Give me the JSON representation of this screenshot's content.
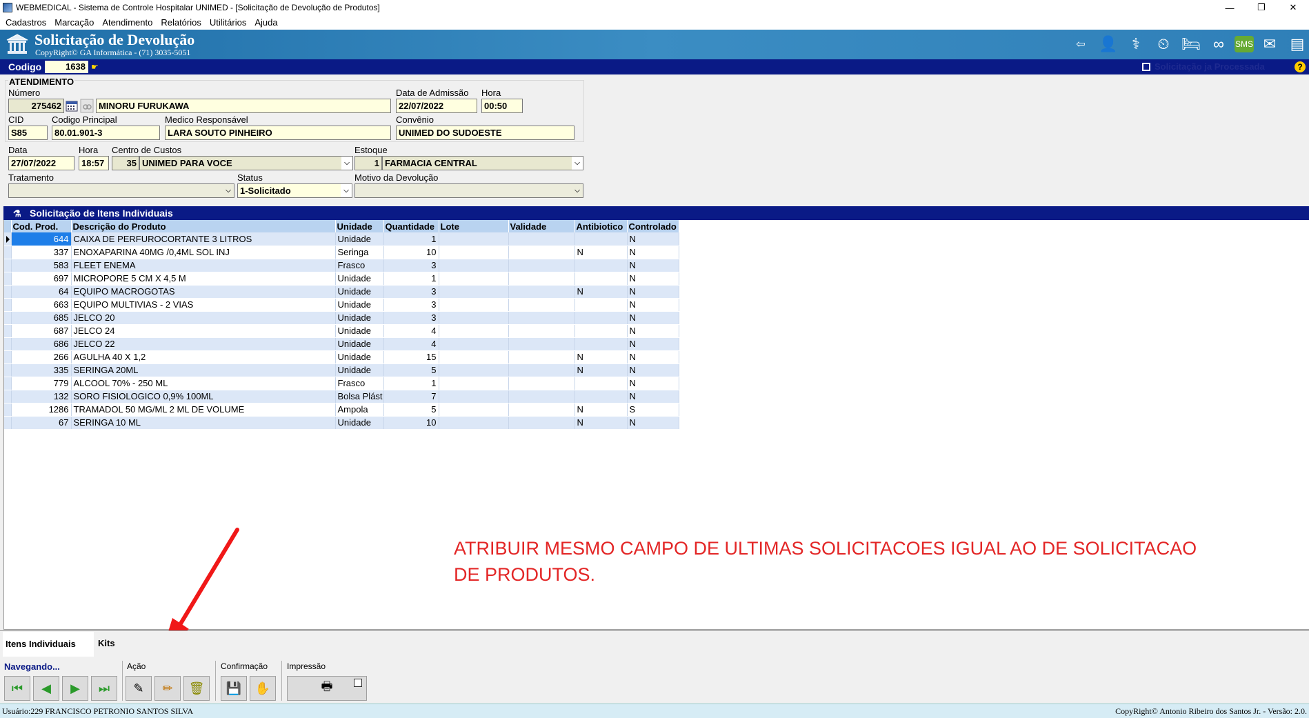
{
  "window": {
    "title": "WEBMEDICAL - Sistema de Controle Hospitalar UNIMED - [Solicitação de Devolução de Produtos]",
    "minimize": "—",
    "restore": "❐",
    "close": "✕"
  },
  "menu": [
    "Cadastros",
    "Marcação",
    "Atendimento",
    "Relatórios",
    "Utilitários",
    "Ajuda"
  ],
  "banner": {
    "title": "Solicitação de Devolução",
    "subtitle": "CopyRight© GA Informática - (71) 3035-5051"
  },
  "codebar": {
    "label": "Codigo",
    "value": "1638",
    "processed_label": "Solicitação ja Processada",
    "help": "?"
  },
  "atendimento": {
    "section_title": "ATENDIMENTO",
    "numero_label": "Número",
    "numero": "275462",
    "patient_name": "MINORU FURUKAWA",
    "admissao_label": "Data de Admissão",
    "admissao": "22/07/2022",
    "hora_label": "Hora",
    "hora": "00:50",
    "cid_label": "CID",
    "cid": "S85",
    "codigo_principal_label": "Codigo Principal",
    "codigo_principal": "80.01.901-3",
    "medico_label": "Medico Responsável",
    "medico": "LARA SOUTO PINHEIRO",
    "convenio_label": "Convênio",
    "convenio": "UNIMED DO SUDOESTE"
  },
  "solicitacao": {
    "data_label": "Data",
    "data": "27/07/2022",
    "hora_label": "Hora",
    "hora": "18:57",
    "centro_label": "Centro de Custos",
    "centro_code": "35",
    "centro_name": "UNIMED PARA VOCE",
    "estoque_label": "Estoque",
    "estoque_code": "1",
    "estoque_name": "FARMACIA CENTRAL",
    "tratamento_label": "Tratamento",
    "tratamento": "",
    "status_label": "Status",
    "status": "1-Solicitado",
    "motivo_label": "Motivo da Devolução",
    "motivo": ""
  },
  "grid": {
    "title": "Solicitação de Itens Individuais",
    "columns": [
      "Cod. Prod.",
      "Descrição do Produto",
      "Unidade",
      "Quantidade",
      "Lote",
      "Validade",
      "Antibiotico",
      "Controlado"
    ],
    "rows": [
      [
        "644",
        "CAIXA DE PERFUROCORTANTE 3 LITROS",
        "Unidade",
        "1",
        "",
        "",
        "",
        "N"
      ],
      [
        "337",
        "ENOXAPARINA 40MG /0,4ML SOL INJ",
        "Seringa",
        "10",
        "",
        "",
        "N",
        "N"
      ],
      [
        "583",
        "FLEET ENEMA",
        "Frasco",
        "3",
        "",
        "",
        "",
        "N"
      ],
      [
        "697",
        "MICROPORE  5 CM X 4,5 M",
        "Unidade",
        "1",
        "",
        "",
        "",
        "N"
      ],
      [
        "64",
        "EQUIPO MACROGOTAS",
        "Unidade",
        "3",
        "",
        "",
        "N",
        "N"
      ],
      [
        "663",
        "EQUIPO MULTIVIAS - 2 VIAS",
        "Unidade",
        "3",
        "",
        "",
        "",
        "N"
      ],
      [
        "685",
        "JELCO 20",
        "Unidade",
        "3",
        "",
        "",
        "",
        "N"
      ],
      [
        "687",
        "JELCO 24",
        "Unidade",
        "4",
        "",
        "",
        "",
        "N"
      ],
      [
        "686",
        "JELCO 22",
        "Unidade",
        "4",
        "",
        "",
        "",
        "N"
      ],
      [
        "266",
        "AGULHA 40 X 1,2",
        "Unidade",
        "15",
        "",
        "",
        "N",
        "N"
      ],
      [
        "335",
        "SERINGA 20ML",
        "Unidade",
        "5",
        "",
        "",
        "N",
        "N"
      ],
      [
        "779",
        "ALCOOL 70% - 250 ML",
        "Frasco",
        "1",
        "",
        "",
        "",
        "N"
      ],
      [
        "132",
        "SORO FISIOLOGICO 0,9% 100ML",
        "Bolsa Plást",
        "7",
        "",
        "",
        "",
        "N"
      ],
      [
        "1286",
        "TRAMADOL 50 MG/ML 2 ML DE VOLUME",
        "Ampola",
        "5",
        "",
        "",
        "N",
        "S"
      ],
      [
        "67",
        "SERINGA 10 ML",
        "Unidade",
        "10",
        "",
        "",
        "N",
        "N"
      ]
    ]
  },
  "annotation": "ATRIBUIR MESMO CAMPO DE ULTIMAS SOLICITACOES IGUAL AO DE SOLICITACAO DE PRODUTOS.",
  "annotation_color": "#e32626",
  "tabs": [
    "Itens Individuais",
    "Kits"
  ],
  "toolbar": {
    "nav_label": "Navegando...",
    "acao_label": "Ação",
    "confirmacao_label": "Confirmação",
    "impressao_label": "Impressão"
  },
  "status": {
    "left": "Usuário:229 FRANCISCO PETRONIO SANTOS SILVA",
    "right": "CopyRight© Antonio Ribeiro dos Santos Jr. - Versão: 2.0."
  }
}
